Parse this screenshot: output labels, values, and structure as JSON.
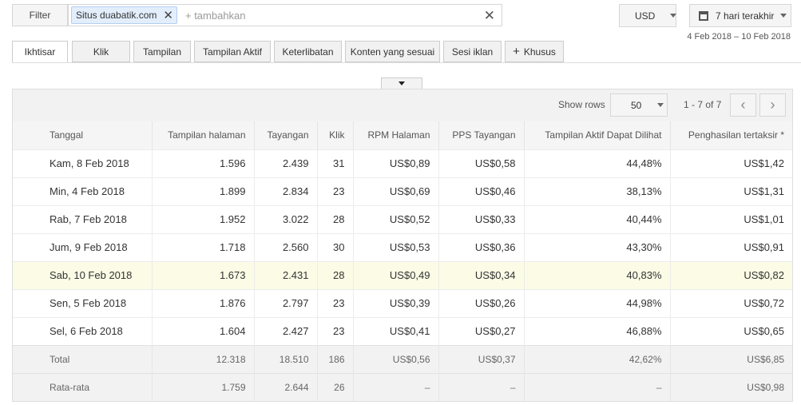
{
  "filter": {
    "button_label": "Filter",
    "chip_prefix": "Situs",
    "chip_value": "duabatik.com",
    "add_placeholder": "+ tambahkan"
  },
  "currency": {
    "selected": "USD"
  },
  "date": {
    "preset": "7 hari terakhir",
    "range": "4 Feb 2018 – 10 Feb 2018"
  },
  "tabs": [
    "Ikhtisar",
    "Klik",
    "Tampilan",
    "Tampilan Aktif",
    "Keterlibatan",
    "Konten yang sesuai",
    "Sesi iklan",
    "Khusus"
  ],
  "toolbar": {
    "show_rows_label": "Show rows",
    "rows_value": "50",
    "range_text": "1 - 7 of 7"
  },
  "table": {
    "headers": [
      "Tanggal",
      "Tampilan halaman",
      "Tayangan",
      "Klik",
      "RPM Halaman",
      "PPS Tayangan",
      "Tampilan Aktif Dapat Dilihat",
      "Penghasilan tertaksir *"
    ],
    "rows": [
      [
        "Kam, 8 Feb 2018",
        "1.596",
        "2.439",
        "31",
        "US$0,89",
        "US$0,58",
        "44,48%",
        "US$1,42"
      ],
      [
        "Min, 4 Feb 2018",
        "1.899",
        "2.834",
        "23",
        "US$0,69",
        "US$0,46",
        "38,13%",
        "US$1,31"
      ],
      [
        "Rab, 7 Feb 2018",
        "1.952",
        "3.022",
        "28",
        "US$0,52",
        "US$0,33",
        "40,44%",
        "US$1,01"
      ],
      [
        "Jum, 9 Feb 2018",
        "1.718",
        "2.560",
        "30",
        "US$0,53",
        "US$0,36",
        "43,30%",
        "US$0,91"
      ],
      [
        "Sab, 10 Feb 2018",
        "1.673",
        "2.431",
        "28",
        "US$0,49",
        "US$0,34",
        "40,83%",
        "US$0,82"
      ],
      [
        "Sen, 5 Feb 2018",
        "1.876",
        "2.797",
        "23",
        "US$0,39",
        "US$0,26",
        "44,98%",
        "US$0,72"
      ],
      [
        "Sel, 6 Feb 2018",
        "1.604",
        "2.427",
        "23",
        "US$0,41",
        "US$0,27",
        "46,88%",
        "US$0,65"
      ]
    ],
    "total": [
      "Total",
      "12.318",
      "18.510",
      "186",
      "US$0,56",
      "US$0,37",
      "42,62%",
      "US$6,85"
    ],
    "average": [
      "Rata-rata",
      "1.759",
      "2.644",
      "26",
      "–",
      "–",
      "–",
      "US$0,98"
    ]
  },
  "colors": {
    "chip_bg": "#e3eefc",
    "highlight_row": "#fbfbe6",
    "summary_bg": "#f2f2f2"
  }
}
